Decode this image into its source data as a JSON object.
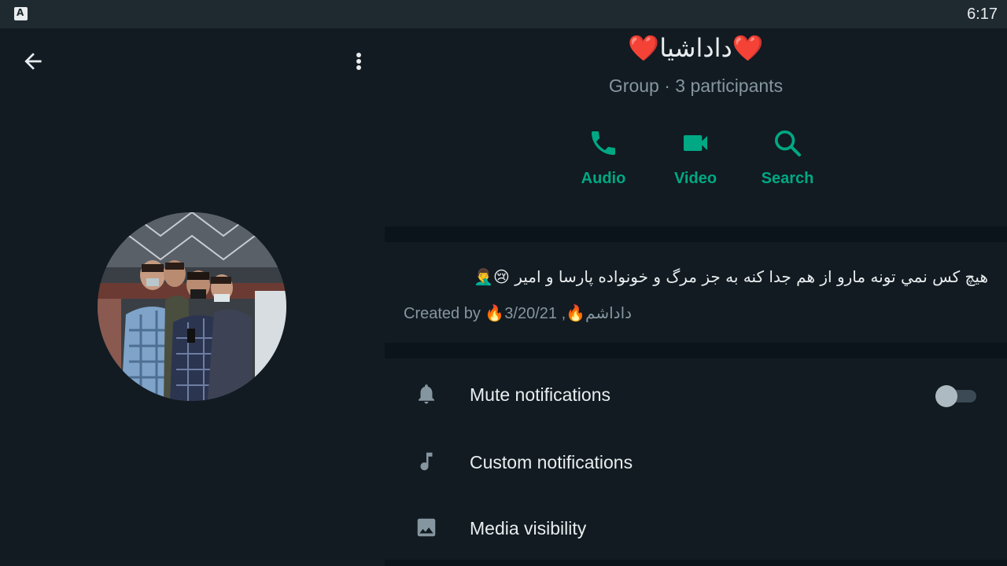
{
  "status_bar": {
    "time": "6:17"
  },
  "header": {
    "back_icon": "arrow-left-icon",
    "menu_icon": "more-vert-icon"
  },
  "group": {
    "title": "❤️داداشیا❤️",
    "subtitle": "Group · 3 participants"
  },
  "actions": [
    {
      "label": "Audio",
      "icon": "phone-icon"
    },
    {
      "label": "Video",
      "icon": "video-camera-icon"
    },
    {
      "label": "Search",
      "icon": "search-icon"
    }
  ],
  "description": {
    "text": "هيچ كس نمي تونه مارو از هم جدا كنه به جز  مرگ و خونواده  پارسا و امير 😢🤦‍♂️",
    "created_by": "Created by 🔥داداشم🔥, 3/20/21"
  },
  "settings": [
    {
      "label": "Mute notifications",
      "icon": "bell-icon",
      "toggle": false
    },
    {
      "label": "Custom notifications",
      "icon": "music-note-icon"
    },
    {
      "label": "Media visibility",
      "icon": "image-icon"
    }
  ],
  "colors": {
    "accent": "#00a884",
    "background": "#111b21",
    "text_primary": "#e9edef",
    "text_secondary": "#8696a0"
  }
}
